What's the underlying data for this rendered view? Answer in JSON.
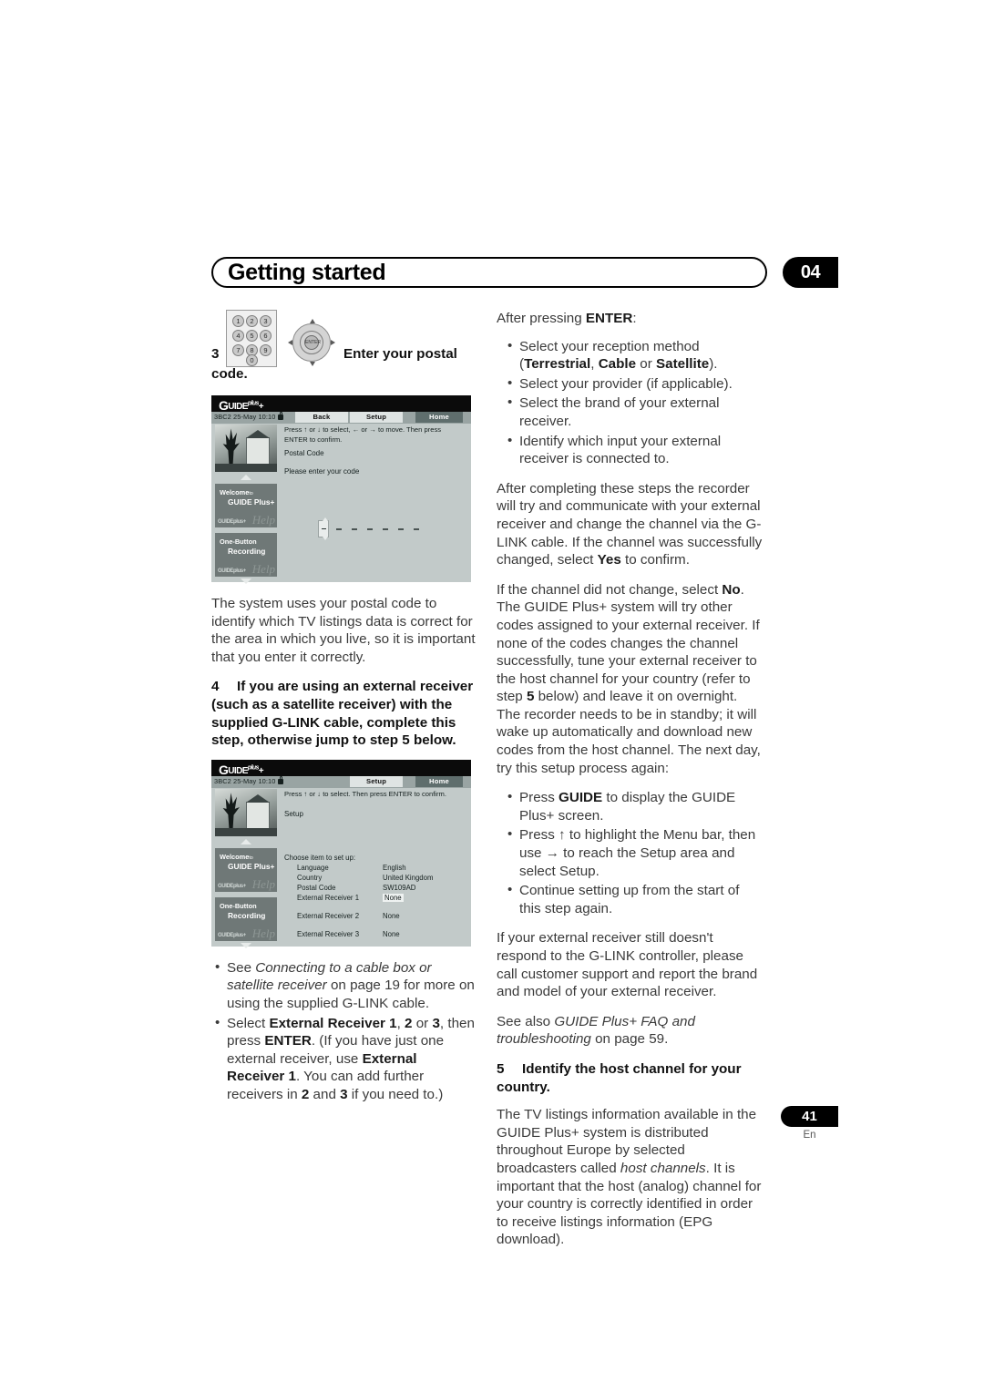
{
  "header": {
    "title": "Getting started",
    "chapter_number": "04"
  },
  "left_column": {
    "step3": {
      "number": "3",
      "label_text": "Enter your postal",
      "label_text2": "code.",
      "keypad_keys": [
        "1",
        "2",
        "3",
        "4",
        "5",
        "6",
        "7",
        "8",
        "9",
        "0"
      ]
    },
    "screenshot1": {
      "logo": "GUIDE Plus+",
      "channel_info": "3BC2   25-May   10:10",
      "buttons": [
        "Back",
        "Setup",
        "Home"
      ],
      "selected_button": "Home",
      "instruction": "Press ↑ or ↓ to select, ← or → to move. Then press ENTER to confirm.",
      "section_title": "Postal Code",
      "prompt": "Please enter your code",
      "card1_line1": "Welcome",
      "card1_line1_small": "to",
      "card1_line2": "GUIDE Plus+",
      "card2_line1": "One-Button",
      "card2_line2": "Recording",
      "help_word": "Help",
      "code_digits": [
        "-",
        "-",
        "-",
        "-",
        "-",
        "-",
        "-"
      ]
    },
    "para_postal": {
      "text": "The system uses your postal code to identify which TV listings data is correct for the area in which you live, so it is important that you enter it correctly."
    },
    "step4": {
      "number": "4",
      "text": "If you are using an external receiver (such as a satellite receiver) with the supplied G-LINK cable, complete this step, otherwise jump to step 5 below."
    },
    "screenshot2": {
      "logo": "GUIDE Plus+",
      "channel_info": "3BC2   25-May   10:10",
      "buttons": [
        "Setup",
        "Home"
      ],
      "selected_button": "Home",
      "instruction": "Press ↑ or ↓ to select. Then press ENTER to confirm.",
      "section_title": "Setup",
      "list_header": "Choose item to set up:",
      "rows": [
        {
          "label": "Language",
          "value": "English",
          "highlight": false
        },
        {
          "label": "Country",
          "value": "United Kingdom",
          "highlight": false
        },
        {
          "label": "Postal Code",
          "value": "SW109AD",
          "highlight": false
        },
        {
          "label": "External Receiver 1",
          "value": "None",
          "highlight": true
        },
        {
          "label": "External Receiver 2",
          "value": "None",
          "highlight": false
        },
        {
          "label": "External Receiver 3",
          "value": "None",
          "highlight": false
        }
      ],
      "card1_line1": "Welcome",
      "card1_line1_small": "to",
      "card1_line2": "GUIDE Plus+",
      "card2_line1": "One-Button",
      "card2_line2": "Recording",
      "help_word": "Help"
    },
    "bullets": [
      {
        "parts": [
          {
            "t": "See ",
            "s": "n"
          },
          {
            "t": "Connecting to a cable box or satellite receiver",
            "s": "i"
          },
          {
            "t": " on page 19 for more on using the supplied G-LINK cable.",
            "s": "n"
          }
        ]
      },
      {
        "parts": [
          {
            "t": "Select ",
            "s": "n"
          },
          {
            "t": "External Receiver 1",
            "s": "b"
          },
          {
            "t": ", ",
            "s": "n"
          },
          {
            "t": "2",
            "s": "b"
          },
          {
            "t": " or ",
            "s": "n"
          },
          {
            "t": "3",
            "s": "b"
          },
          {
            "t": ", then press ",
            "s": "n"
          },
          {
            "t": "ENTER",
            "s": "b"
          },
          {
            "t": ". (If you have just one external receiver, use ",
            "s": "n"
          },
          {
            "t": "External Receiver 1",
            "s": "b"
          },
          {
            "t": ". You can add further receivers in ",
            "s": "n"
          },
          {
            "t": "2",
            "s": "b"
          },
          {
            "t": " and ",
            "s": "n"
          },
          {
            "t": "3",
            "s": "b"
          },
          {
            "t": " if you need to.)",
            "s": "n"
          }
        ]
      }
    ]
  },
  "right_column": {
    "after_enter_intro": "After pressing ENTER:",
    "after_enter_intro_bold": "ENTER",
    "after_enter_bullets": [
      {
        "parts": [
          {
            "t": "Select your reception method (",
            "s": "n"
          },
          {
            "t": "Terrestrial",
            "s": "b"
          },
          {
            "t": ", ",
            "s": "n"
          },
          {
            "t": "Cable",
            "s": "b"
          },
          {
            "t": " or ",
            "s": "n"
          },
          {
            "t": "Satellite",
            "s": "b"
          },
          {
            "t": ").",
            "s": "n"
          }
        ]
      },
      {
        "parts": [
          {
            "t": "Select your provider (if applicable).",
            "s": "n"
          }
        ]
      },
      {
        "parts": [
          {
            "t": "Select the brand of your external receiver.",
            "s": "n"
          }
        ]
      },
      {
        "parts": [
          {
            "t": "Identify which input your external receiver is connected to.",
            "s": "n"
          }
        ]
      }
    ],
    "para_after_completing": {
      "parts": [
        {
          "t": "After completing these steps the recorder will try and communicate with your external receiver and change the channel via the G-LINK cable. If the channel was successfully changed, select ",
          "s": "n"
        },
        {
          "t": "Yes",
          "s": "b"
        },
        {
          "t": " to confirm.",
          "s": "n"
        }
      ]
    },
    "para_if_channel": {
      "parts": [
        {
          "t": "If the channel did not change, select ",
          "s": "n"
        },
        {
          "t": "No",
          "s": "b"
        },
        {
          "t": ". The GUIDE Plus+ system will try other codes assigned to your external receiver. If none of the codes changes the channel successfully, tune your external receiver to the host channel for your country (refer to step ",
          "s": "n"
        },
        {
          "t": "5",
          "s": "b"
        },
        {
          "t": " below) and leave it on overnight. The recorder needs to be in standby; it will wake up automatically and download new codes from the host channel. The next day, try this setup process again:",
          "s": "n"
        }
      ]
    },
    "retry_bullets": [
      {
        "parts": [
          {
            "t": "Press ",
            "s": "n"
          },
          {
            "t": "GUIDE",
            "s": "b"
          },
          {
            "t": " to display the GUIDE Plus+ screen.",
            "s": "n"
          }
        ]
      },
      {
        "parts": [
          {
            "t": "Press ↑ to highlight the Menu bar, then use → to reach the Setup area and select Setup.",
            "s": "n"
          }
        ]
      },
      {
        "parts": [
          {
            "t": "Continue setting up from the start of this step again.",
            "s": "n"
          }
        ]
      }
    ],
    "para_still_not_respond": {
      "parts": [
        {
          "t": "If your external receiver still doesn't respond to the G-LINK controller, please call customer support and report the brand and model of your external receiver.",
          "s": "n"
        }
      ]
    },
    "para_see_also": {
      "parts": [
        {
          "t": "See also ",
          "s": "n"
        },
        {
          "t": "GUIDE Plus+ FAQ and troubleshooting",
          "s": "i"
        },
        {
          "t": " on page 59.",
          "s": "n"
        }
      ]
    },
    "step5": {
      "number": "5",
      "text": "Identify the host channel for your country."
    },
    "para_tv_listings": {
      "parts": [
        {
          "t": "The TV listings information available in the GUIDE Plus+ system is distributed throughout Europe by selected broadcasters called ",
          "s": "n"
        },
        {
          "t": "host channels",
          "s": "i"
        },
        {
          "t": ". It is important that the host (analog) channel for your country is correctly identified in order to receive listings information (EPG download).",
          "s": "n"
        }
      ]
    }
  },
  "footer": {
    "page_number": "41",
    "language": "En"
  }
}
